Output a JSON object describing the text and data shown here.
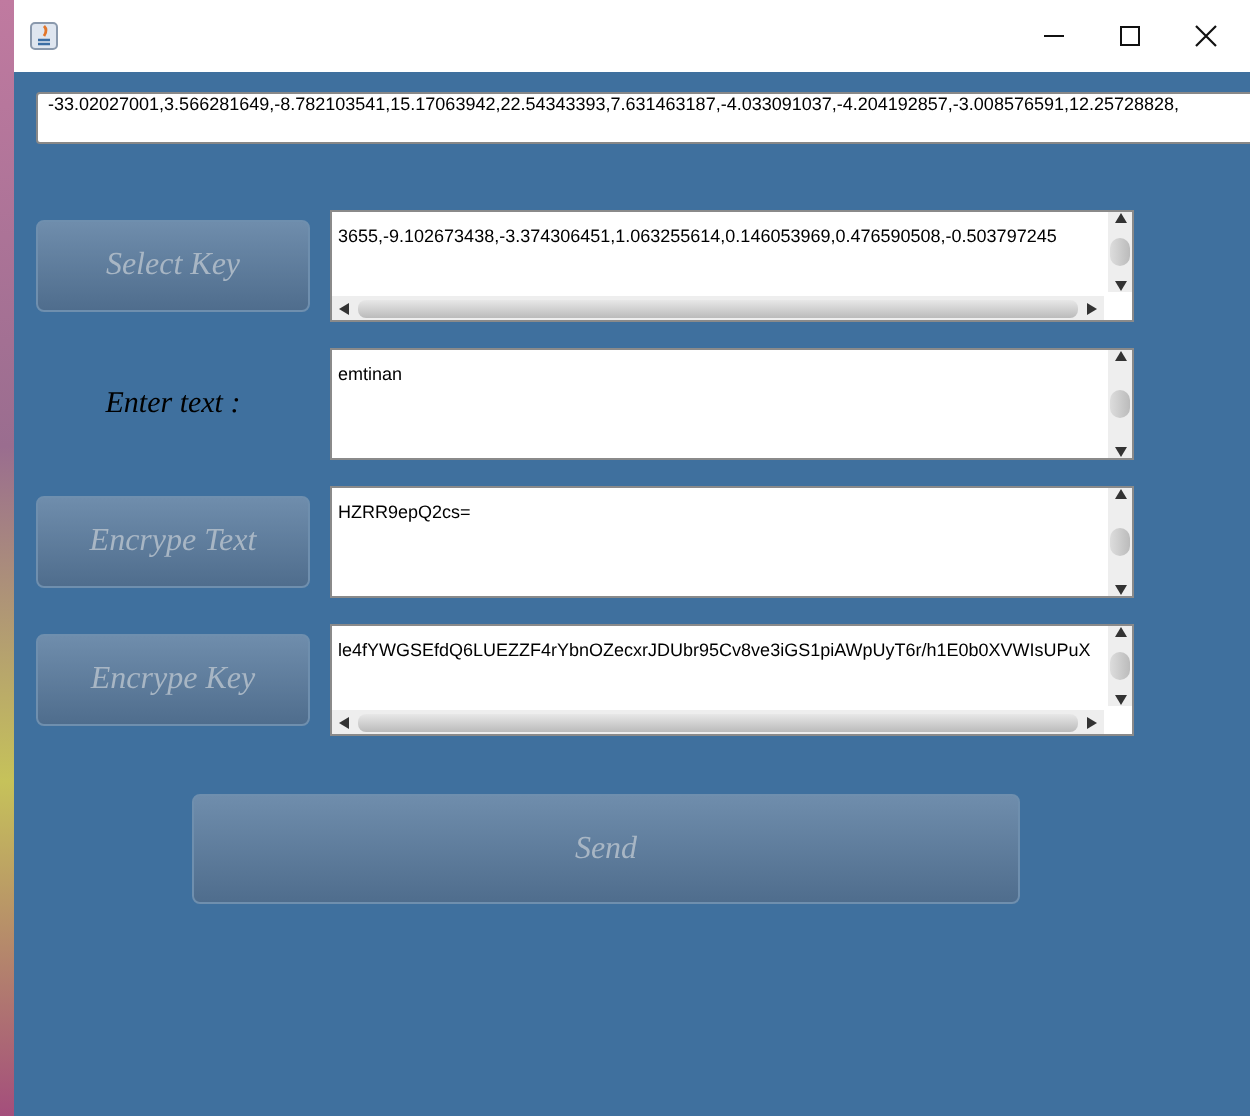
{
  "top_field": {
    "value": "-33.02027001,3.566281649,-8.782103541,15.17063942,22.54343393,7.631463187,-4.033091037,-4.204192857,-3.008576591,12.25728828,"
  },
  "rows": [
    {
      "kind": "button",
      "label": "Select Key",
      "field": {
        "value": "3655,-9.102673438,-3.374306451,1.063255614,0.146053969,0.476590508,-0.503797245",
        "hscroll": true
      }
    },
    {
      "kind": "label",
      "label": "Enter text :",
      "field": {
        "value": "emtinan",
        "hscroll": false
      }
    },
    {
      "kind": "button",
      "label": "Encrype Text",
      "field": {
        "value": "HZRR9epQ2cs=",
        "hscroll": false
      }
    },
    {
      "kind": "button",
      "label": "Encrype Key",
      "field": {
        "value": "le4fYWGSEfdQ6LUEZZF4rYbnOZecxrJDUbr95Cv8ve3iGS1piAWpUyT6r/h1E0b0XVWIsUPuX",
        "hscroll": true
      }
    }
  ],
  "send": {
    "label": "Send"
  }
}
